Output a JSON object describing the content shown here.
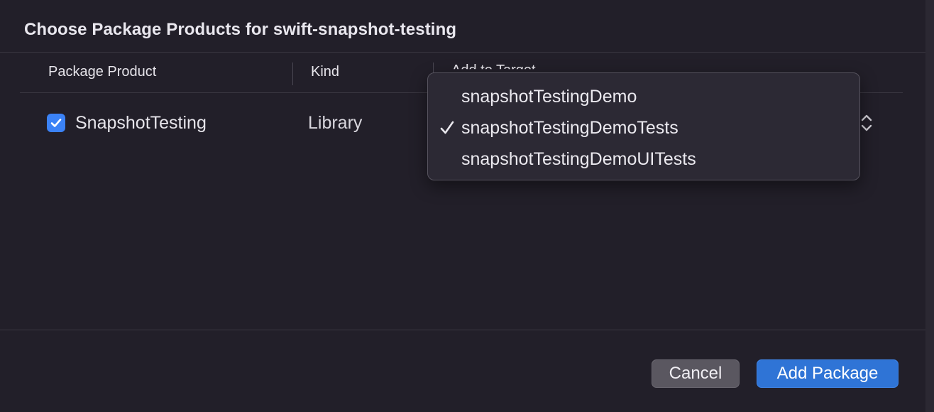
{
  "dialog": {
    "title": "Choose Package Products for swift-snapshot-testing"
  },
  "table": {
    "headers": {
      "product": "Package Product",
      "kind": "Kind",
      "target": "Add to Target"
    },
    "rows": [
      {
        "checked": true,
        "product": "SnapshotTesting",
        "kind": "Library",
        "target": "snapshotTestingDemoTests"
      }
    ]
  },
  "target_menu": {
    "items": [
      {
        "label": "snapshotTestingDemo",
        "checked": false
      },
      {
        "label": "snapshotTestingDemoTests",
        "checked": true
      },
      {
        "label": "snapshotTestingDemoUITests",
        "checked": false
      }
    ]
  },
  "buttons": {
    "cancel": "Cancel",
    "add": "Add Package"
  },
  "colors": {
    "accent": "#2f74d6",
    "checkbox": "#3b82f6",
    "background": "#221f29"
  },
  "icons": {
    "checkbox": "checkbox-checked-icon",
    "menu_check": "checkmark-icon",
    "popup": "chevron-up-down-icon"
  }
}
